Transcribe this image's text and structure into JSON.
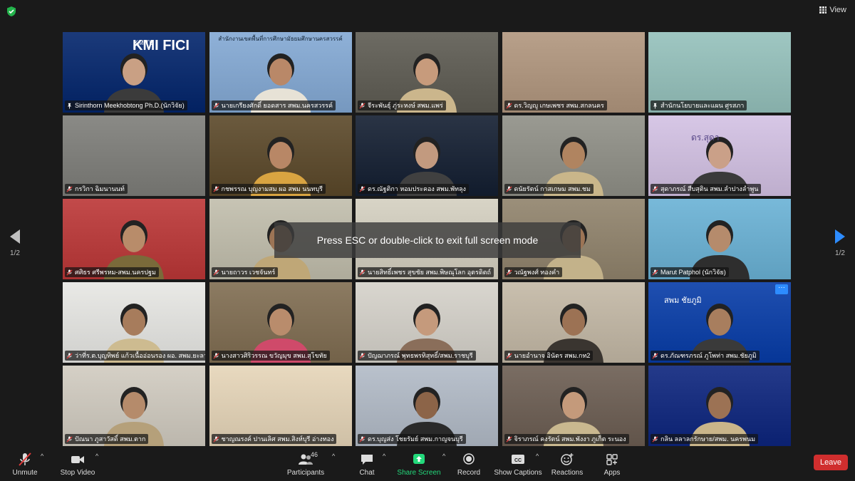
{
  "window": {
    "view_label": "View"
  },
  "gallery": {
    "tiles": [
      {
        "name": "Sirinthorn Meekhobtong Ph.D.(นักวิจัย)",
        "muted": false,
        "active": true,
        "bg": "#1b3a7a",
        "skin": "#c9a084",
        "shirt": "#3b3b3b",
        "logo1": "KMITL",
        "logo2": "KMI FICI"
      },
      {
        "name": "นายเกรียงศักดิ์ ยอดสาร สพม.นครสวรรค์",
        "muted": true,
        "bg": "#8fb1d8",
        "skin": "#b98868",
        "shirt": "#e7e2d6",
        "banner": "สำนักงานเขตพื้นที่การศึกษามัธยมศึกษานครสวรรค์"
      },
      {
        "name": "จีระพันธุ์ ภู่ระหงษ์ สพม.แพร่",
        "muted": true,
        "bg": "#6d6b63",
        "skin": "#c79b7c",
        "shirt": "#cbb68c"
      },
      {
        "name": "ดร.วิญญู เกษเพชร สพม.สกลนคร",
        "muted": true,
        "bg": "#b8a08a",
        "skin": null,
        "shirt": null
      },
      {
        "name": "สำนักนโยบายและแผน ศูรสภา",
        "muted": false,
        "bg": "#9fc7c2",
        "skin": null,
        "shirt": null
      },
      {
        "name": "กรวิกา ฉิมนานนท์",
        "muted": true,
        "bg": "#8a8a86",
        "skin": null,
        "shirt": null
      },
      {
        "name": "กชพรรณ บุญงามสม ผอ สพม นนทบุรี",
        "muted": true,
        "bg": "#6b5a3e",
        "skin": "#b88766",
        "shirt": "#d9a441"
      },
      {
        "name": "ดร.ณัฐติกา หอมประคอง สพม.พัทลุง",
        "muted": true,
        "bg": "#2a3445",
        "skin": "#c29a7f",
        "shirt": "#404040"
      },
      {
        "name": "ดนัยรัตน์ กาสเกษม สพม.ชม",
        "muted": true,
        "bg": "#9a9a92",
        "skin": "#b08460",
        "shirt": "#c9b68a"
      },
      {
        "name": "สุดาภรณ์ สืบสุติน สพม.ลำปางลำพูน",
        "muted": true,
        "bg": "#d7c7e6",
        "skin": "#caa088",
        "shirt": "#3a3a3a",
        "wall": "ดร.สุดา"
      },
      {
        "name": "ศศิธร ศรีพรหม-สพม.นครปฐม",
        "muted": true,
        "bg": "#c24a4a",
        "skin": "#b88c6a",
        "shirt": "#7a6a3a"
      },
      {
        "name": "นายถาวร เวชจันทร์",
        "muted": true,
        "bg": "#c7c4b4",
        "skin": "#9c7455",
        "shirt": "#bfa777"
      },
      {
        "name": "นายสิทธิ์เพชร สุขชัย สพม.พิษณุโลก อุตรดิตถ์",
        "muted": true,
        "bg": "#d8d4c6",
        "skin": null,
        "shirt": null
      },
      {
        "name": "วณัฐพงศ์ ทองคำ",
        "muted": true,
        "bg": "#9b8f7a",
        "skin": "#9c7455",
        "shirt": "#c3b28a"
      },
      {
        "name": "Marut Patphol (นักวิจัย)",
        "muted": true,
        "bg": "#78b9d9",
        "skin": "#b58b6c",
        "shirt": "#2e2e2e"
      },
      {
        "name": "ว่าที่ร.ต.บุญทิพย์ แก้วเนื้ออ่อนรอง ผอ. สพม.ยะลา",
        "muted": true,
        "bg": "#e9e9e6",
        "skin": "#a77c5c",
        "shirt": "#cdbb90"
      },
      {
        "name": "นางสาวศิริวรรณ ขวัญมุข สพม.สุโขทัย",
        "muted": true,
        "bg": "#8c7b62",
        "skin": "#b98c6c",
        "shirt": "#cf4a6a"
      },
      {
        "name": "ปัญฌาภรณ์ พุทธพรทิสุทธิ์/สพม.ราชบุรี",
        "muted": true,
        "bg": "#d9d6cf",
        "skin": "#c59a7c",
        "shirt": "#8a6e5a"
      },
      {
        "name": "นายอำนาจ อินัตร สพม.กท2",
        "muted": true,
        "bg": "#c9bfae",
        "skin": "#9c7254",
        "shirt": "#3a3530"
      },
      {
        "name": "ดร.ภัณฑรภรณ์ ภูโพท่า สพม.ชัยภูมิ",
        "muted": true,
        "bg": "#1f4fb0",
        "skin": "#a87e5e",
        "shirt": "#3a3a3a",
        "more": true,
        "corner": "สพม ชัยภูมิ"
      },
      {
        "name": "ปัณนา ภูสาวัสดิ์ สพม.ตาก",
        "muted": true,
        "bg": "#d5d0c6",
        "skin": "#b58b6b",
        "shirt": "#b5a07a"
      },
      {
        "name": "ชาญณรงค์ ปานเลิศ สพม.สิงห์บุรี อ่างทอง",
        "muted": true,
        "bg": "#e8d9bf",
        "skin": null,
        "shirt": null
      },
      {
        "name": "ดร.บุญส่ง โชยรัมย์ สพม.กาญจนบุรี",
        "muted": true,
        "bg": "#b9c1cc",
        "skin": "#8c6448",
        "shirt": "#2a2a2a"
      },
      {
        "name": "จิราภรณ์ คงรัตน์ สพม.พังงา ภูเก็ต ระนอง",
        "muted": true,
        "bg": "#7a6d63",
        "skin": "#c49a7b",
        "shirt": "#c9b88f"
      },
      {
        "name": "กลิน ลลาลกรักษาย/สพม. นครพนม",
        "muted": true,
        "bg": "#243a8a",
        "skin": "#9c7254",
        "shirt": "#c9b58a"
      }
    ]
  },
  "pagination": {
    "left": "1/2",
    "right": "1/2"
  },
  "toast": "Press ESC or double-click to exit full screen mode",
  "toolbar": {
    "unmute": "Unmute",
    "stop_video": "Stop Video",
    "participants": "Participants",
    "participants_count": "46",
    "chat": "Chat",
    "share": "Share Screen",
    "record": "Record",
    "captions": "Show Captions",
    "captions_badge": "CC",
    "reactions": "Reactions",
    "apps": "Apps",
    "leave": "Leave"
  },
  "colors": {
    "accent_blue": "#2d8cff",
    "share_green": "#23d97b",
    "leave_red": "#d02e2e",
    "active_outline": "#cbd86c"
  }
}
